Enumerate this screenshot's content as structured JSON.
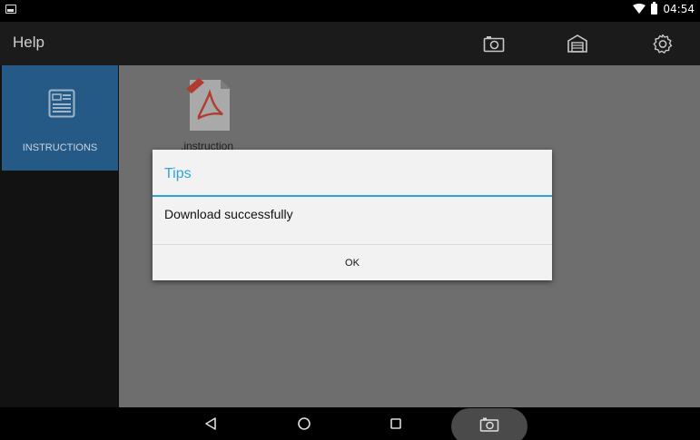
{
  "status_bar": {
    "time": "04:54"
  },
  "app_bar": {
    "title": "Help"
  },
  "sidebar": {
    "items": [
      {
        "label": "INSTRUCTIONS",
        "selected": true
      }
    ]
  },
  "files": [
    {
      "name": ".instruction",
      "type": "pdf"
    }
  ],
  "dialog": {
    "title": "Tips",
    "message": "Download successfully",
    "ok_label": "OK"
  },
  "colors": {
    "accent": "#2aa7d8",
    "sidebar_selected": "#265a86",
    "pdf_red": "#c0392b"
  },
  "icons": {
    "app_bar": [
      "camera-icon",
      "garage-icon",
      "settings-gear-icon"
    ],
    "nav_bar": [
      "back-icon",
      "home-icon",
      "recents-icon",
      "screenshot-camera-icon"
    ]
  }
}
